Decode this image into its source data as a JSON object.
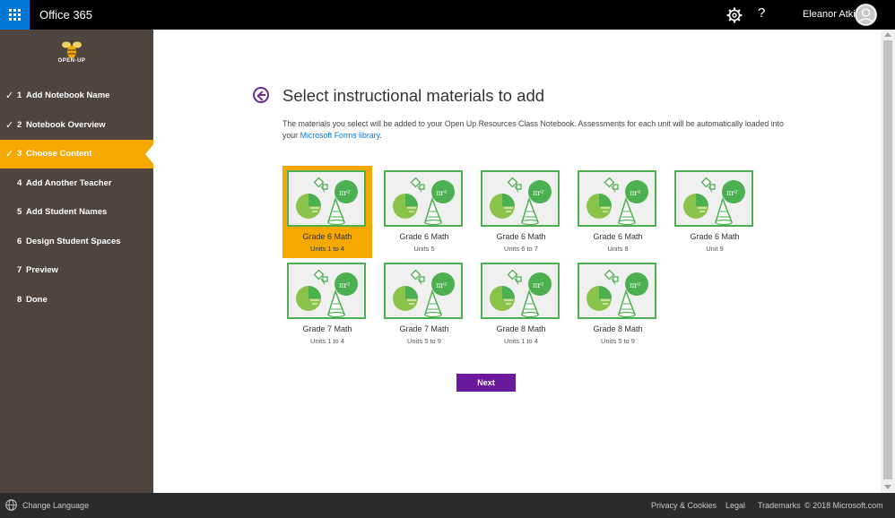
{
  "topbar": {
    "app_title": "Office 365",
    "help_label": "?",
    "user_name": "Eleanor Atkins",
    "accent": "#0078d7"
  },
  "sidebar": {
    "logo_text": "OPEN·UP",
    "steps": [
      {
        "num": "1",
        "label": "Add Notebook Name",
        "done": true
      },
      {
        "num": "2",
        "label": "Notebook Overview",
        "done": true
      },
      {
        "num": "3",
        "label": "Choose Content",
        "done": true,
        "active": true
      },
      {
        "num": "4",
        "label": "Add Another Teacher",
        "done": false
      },
      {
        "num": "5",
        "label": "Add Student Names",
        "done": false
      },
      {
        "num": "6",
        "label": "Design Student Spaces",
        "done": false
      },
      {
        "num": "7",
        "label": "Preview",
        "done": false
      },
      {
        "num": "8",
        "label": "Done",
        "done": false
      }
    ],
    "check_glyph": "✓",
    "active_color": "#f5a800"
  },
  "main": {
    "title": "Select instructional materials to add",
    "description": "The materials you select will be added to your Open Up Resources Class Notebook. Assessments for each unit will be automatically loaded into your ",
    "description_link": "Microsoft Forms library",
    "description_end": ".",
    "materials": [
      {
        "title": "Grade 6 Math",
        "units": "Units 1 to 4",
        "selected": true
      },
      {
        "title": "Grade 6 Math",
        "units": "Units 5",
        "selected": false
      },
      {
        "title": "Grade 6 Math",
        "units": "Units 6 to 7",
        "selected": false
      },
      {
        "title": "Grade 6 Math",
        "units": "Units 8",
        "selected": false
      },
      {
        "title": "Grade 6 Math",
        "units": "Unit 9",
        "selected": false
      },
      {
        "title": "Grade 7 Math",
        "units": "Units 1 to 4",
        "selected": false
      },
      {
        "title": "Grade 7 Math",
        "units": "Units 5 to 9",
        "selected": false
      },
      {
        "title": "Grade 8 Math",
        "units": "Units 1 to 4",
        "selected": false
      },
      {
        "title": "Grade 8 Math",
        "units": "Units 5 to 9",
        "selected": false
      }
    ],
    "next_label": "Next",
    "next_color": "#6b1a9b"
  },
  "footer": {
    "change_language": "Change Language",
    "privacy": "Privacy & Cookies",
    "legal": "Legal",
    "trademarks": "Trademarks",
    "copyright": "© 2018 Microsoft.com"
  }
}
